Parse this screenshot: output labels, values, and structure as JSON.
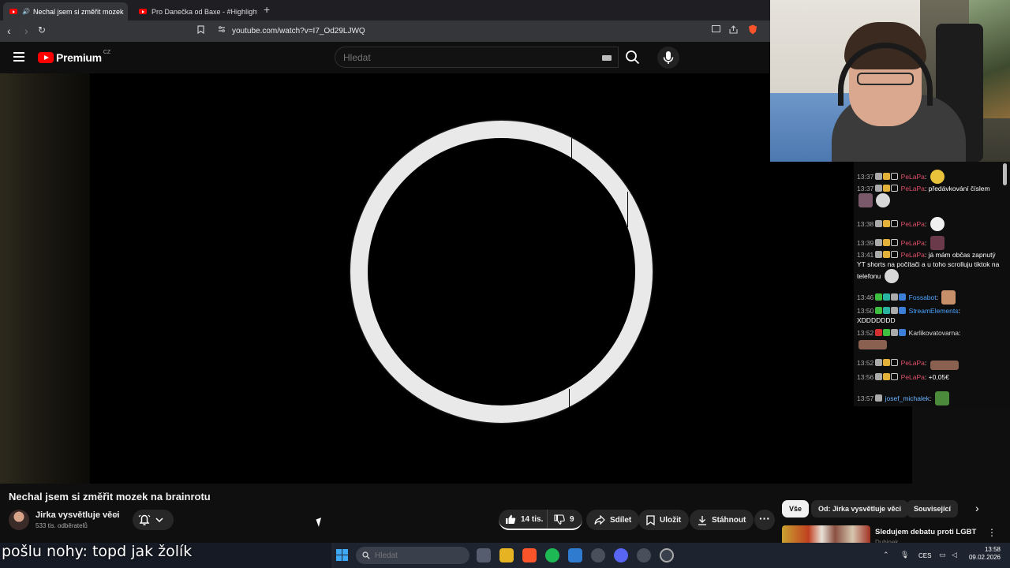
{
  "browser": {
    "tabs": [
      {
        "label": "Nechal jsem si změřit mozek",
        "active": true
      },
      {
        "label": "Pro Danečka od Baxe - #Highlights",
        "active": false
      }
    ],
    "url": "youtube.com/watch?v=I7_Od29LJWQ"
  },
  "masthead": {
    "logo_text": "Premium",
    "country_code": "CZ",
    "search_placeholder": "Hledat"
  },
  "video": {
    "title": "Nechal jsem si změřit mozek na brainrotu",
    "channel": "Jirka vysvětluje věci",
    "subscribers": "533 tis. odběratelů",
    "likes": "14 tis.",
    "dislikes": "9",
    "share_label": "Sdílet",
    "save_label": "Uložit",
    "download_label": "Stáhnout"
  },
  "chips": [
    "Vše",
    "Od: Jirka vysvětluje věci",
    "Související"
  ],
  "recommendation": {
    "title": "Sledujem debatu proti LGBT",
    "channel": "Dubinek"
  },
  "chat": [
    {
      "time": "13:37",
      "user": "PeLaPa",
      "text": ""
    },
    {
      "time": "13:37",
      "user": "PeLaPa",
      "text": "předávkování číslem"
    },
    {
      "time": "13:38",
      "user": "PeLaPa",
      "text": ""
    },
    {
      "time": "13:39",
      "user": "PeLaPa",
      "text": ""
    },
    {
      "time": "13:41",
      "user": "PeLaPa",
      "text": "já mám občas zapnutý YT shorts na počítači a u toho scrolluju tiktok na telefonu"
    },
    {
      "time": "13:46",
      "user": "Fossabot",
      "text": ""
    },
    {
      "time": "13:50",
      "user": "StreamElements",
      "text": "XDDDDDDD"
    },
    {
      "time": "13:52",
      "user": "Karlikovatovarna",
      "text": ""
    },
    {
      "time": "13:52",
      "user": "PeLaPa",
      "text": ""
    },
    {
      "time": "13:56",
      "user": "PeLaPa",
      "text": "+0,05€"
    },
    {
      "time": "13:57",
      "user": "josef_michalek",
      "text": ""
    }
  ],
  "caption": "pošlu nohy: topd jak žolík",
  "taskbar": {
    "search_placeholder": "Hledat",
    "language": "CES",
    "time": "13:58",
    "date": "09.02.2026"
  },
  "colors": {
    "pelapa": "#e0506a",
    "bot": "#4aa3ff",
    "josef": "#6ab3ff",
    "karlik": "#dddddd"
  }
}
